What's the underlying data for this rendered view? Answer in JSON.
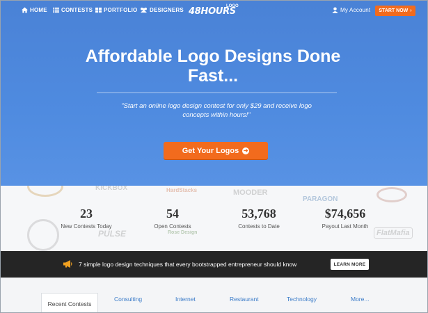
{
  "nav": {
    "items": [
      {
        "label": "HOME",
        "icon": "home-icon"
      },
      {
        "label": "CONTESTS",
        "icon": "list-icon"
      },
      {
        "label": "PORTFOLIO",
        "icon": "grid-icon"
      },
      {
        "label": "DESIGNERS",
        "icon": "users-icon"
      }
    ],
    "logo": {
      "main": "48HOURS",
      "sub": "LOGO"
    },
    "account_label": "My Account",
    "start_label": "START NOW"
  },
  "hero": {
    "title": "Affordable Logo Designs Done Fast...",
    "subtitle": "\"Start an online logo design contest for only $29 and receive logo concepts within hours!\"",
    "cta_label": "Get Your Logos"
  },
  "stats": [
    {
      "value": "23",
      "label": "New Contests Today"
    },
    {
      "value": "54",
      "label": "Open Contests"
    },
    {
      "value": "53,768",
      "label": "Contests to Date"
    },
    {
      "value": "$74,656",
      "label": "Payout Last Month"
    }
  ],
  "background_logos": [
    "KICKBOX",
    "HardStacks",
    "MOODER",
    "PARAGON",
    "PULSE",
    "Rose Design",
    "FlatMafia"
  ],
  "banner": {
    "text": "7 simple logo design techniques that every bootstrapped entrepreneur should know",
    "button_label": "LEARN MORE"
  },
  "tabs": [
    "Recent Contests",
    "Consulting",
    "Internet",
    "Restaurant",
    "Technology",
    "More..."
  ],
  "colors": {
    "hero": "#4f8be0",
    "accent": "#f26b1d",
    "banner": "#252525",
    "link": "#3a7bc8"
  }
}
